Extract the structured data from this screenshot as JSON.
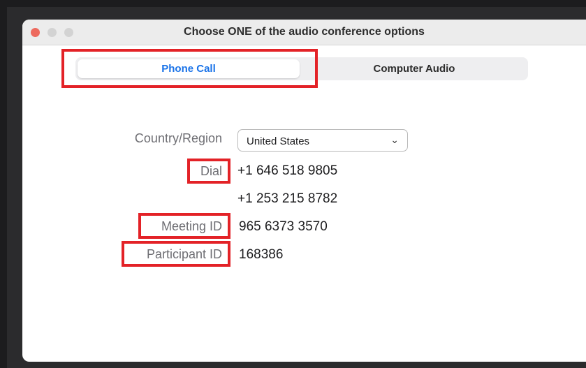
{
  "window": {
    "title": "Choose ONE of the audio conference options"
  },
  "tabs": [
    {
      "label": "Phone Call",
      "selected": true
    },
    {
      "label": "Computer Audio",
      "selected": false
    }
  ],
  "form": {
    "country_label": "Country/Region",
    "country_value": "United States",
    "dial_label": "Dial",
    "dial_numbers": [
      "+1 646 518 9805",
      "+1 253 215 8782"
    ],
    "meeting_id_label": "Meeting ID",
    "meeting_id_value": "965 6373 3570",
    "participant_id_label": "Participant ID",
    "participant_id_value": "168386"
  },
  "icons": {
    "country_dropdown": "chevron-down-icon"
  },
  "colors": {
    "highlight": "#e32227",
    "accent": "#1a73e8"
  }
}
